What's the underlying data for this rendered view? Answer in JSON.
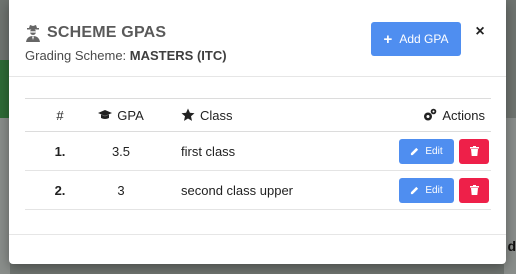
{
  "modal": {
    "title": "SCHEME GPAS",
    "subtitle_prefix": "Grading Scheme:",
    "scheme_name": "MASTERS (ITC)",
    "add_button_label": "Add GPA",
    "close_glyph": "×",
    "title_icon": "user-secret-icon"
  },
  "table": {
    "headers": {
      "num": "#",
      "gpa": "GPA",
      "class": "Class",
      "actions": "Actions"
    },
    "rows": [
      {
        "num": "1.",
        "gpa": "3.5",
        "class": "first class",
        "edit_label": "Edit"
      },
      {
        "num": "2.",
        "gpa": "3",
        "class": "second class upper",
        "edit_label": "Edit"
      }
    ]
  },
  "backdrop": {
    "partial_text": "d"
  },
  "colors": {
    "primary": "#4f8ef0",
    "danger": "#ee2049",
    "title": "#5a5a5a"
  }
}
